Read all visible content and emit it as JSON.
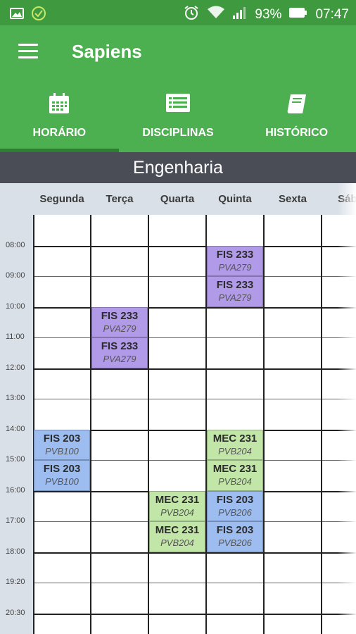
{
  "status": {
    "battery": "93%",
    "time": "07:47"
  },
  "app": {
    "title": "Sapiens"
  },
  "tabs": [
    {
      "label": "HORÁRIO",
      "icon": "calendar-icon",
      "active": true
    },
    {
      "label": "DISCIPLINAS",
      "icon": "list-icon",
      "active": false
    },
    {
      "label": "HISTÓRICO",
      "icon": "book-icon",
      "active": false
    }
  ],
  "section": {
    "title": "Engenharia"
  },
  "days": [
    "Segunda",
    "Terça",
    "Quarta",
    "Quinta",
    "Sexta",
    "Sába"
  ],
  "times": [
    "08:00",
    "09:00",
    "10:00",
    "11:00",
    "12:00",
    "13:00",
    "14:00",
    "15:00",
    "16:00",
    "17:00",
    "18:00",
    "19:20",
    "20:30"
  ],
  "colors": {
    "purple": "#b19ae8",
    "blue": "#9dbdf1",
    "green": "#c2e6a8",
    "appbar": "#4caf50",
    "statusbar": "#3f9a3f",
    "section": "#4a4d55"
  },
  "classes": [
    {
      "day": "Quinta",
      "time": "08:00",
      "code": "FIS 233",
      "room": "PVA279",
      "color": "purple"
    },
    {
      "day": "Quinta",
      "time": "09:00",
      "code": "FIS 233",
      "room": "PVA279",
      "color": "purple"
    },
    {
      "day": "Terça",
      "time": "10:00",
      "code": "FIS 233",
      "room": "PVA279",
      "color": "purple"
    },
    {
      "day": "Terça",
      "time": "11:00",
      "code": "FIS 233",
      "room": "PVA279",
      "color": "purple"
    },
    {
      "day": "Segunda",
      "time": "14:00",
      "code": "FIS 203",
      "room": "PVB100",
      "color": "blue"
    },
    {
      "day": "Segunda",
      "time": "15:00",
      "code": "FIS 203",
      "room": "PVB100",
      "color": "blue"
    },
    {
      "day": "Quinta",
      "time": "14:00",
      "code": "MEC 231",
      "room": "PVB204",
      "color": "green"
    },
    {
      "day": "Quinta",
      "time": "15:00",
      "code": "MEC 231",
      "room": "PVB204",
      "color": "green"
    },
    {
      "day": "Quarta",
      "time": "16:00",
      "code": "MEC 231",
      "room": "PVB204",
      "color": "green"
    },
    {
      "day": "Quarta",
      "time": "17:00",
      "code": "MEC 231",
      "room": "PVB204",
      "color": "green"
    },
    {
      "day": "Quinta",
      "time": "16:00",
      "code": "FIS 203",
      "room": "PVB206",
      "color": "blue"
    },
    {
      "day": "Quinta",
      "time": "17:00",
      "code": "FIS 203",
      "room": "PVB206",
      "color": "blue"
    }
  ]
}
